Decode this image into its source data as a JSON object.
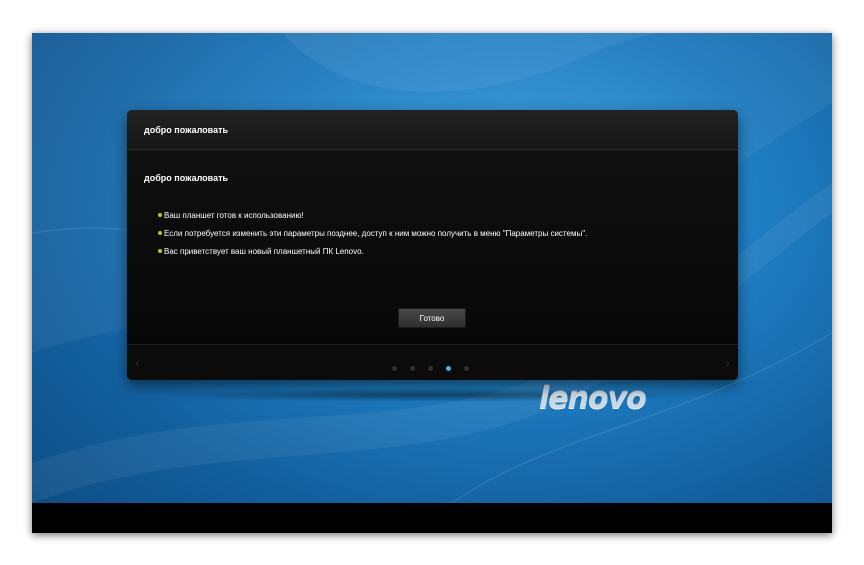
{
  "dialog": {
    "header_title": "добро пожаловать",
    "body_title": "добро пожаловать",
    "bullets": [
      "Ваш планшет готов к использованию!",
      "Если потребуется изменить эти параметры позднее, доступ к ним можно получить в меню \"Параметры системы\".",
      "Вас приветствует ваш новый планшетный ПК Lenovo."
    ],
    "done_label": "Готово",
    "page_indicator": {
      "total": 5,
      "current": 4
    },
    "prev_icon": "chevron-left-icon",
    "next_icon": "chevron-right-icon"
  },
  "logo": {
    "text": "lenovo"
  },
  "colors": {
    "accent_blue": "#48b2ea",
    "bullet_green": "#a5d21a",
    "dialog_bg": "#0e0e0e",
    "wallpaper_blue": "#1f7fc4"
  }
}
